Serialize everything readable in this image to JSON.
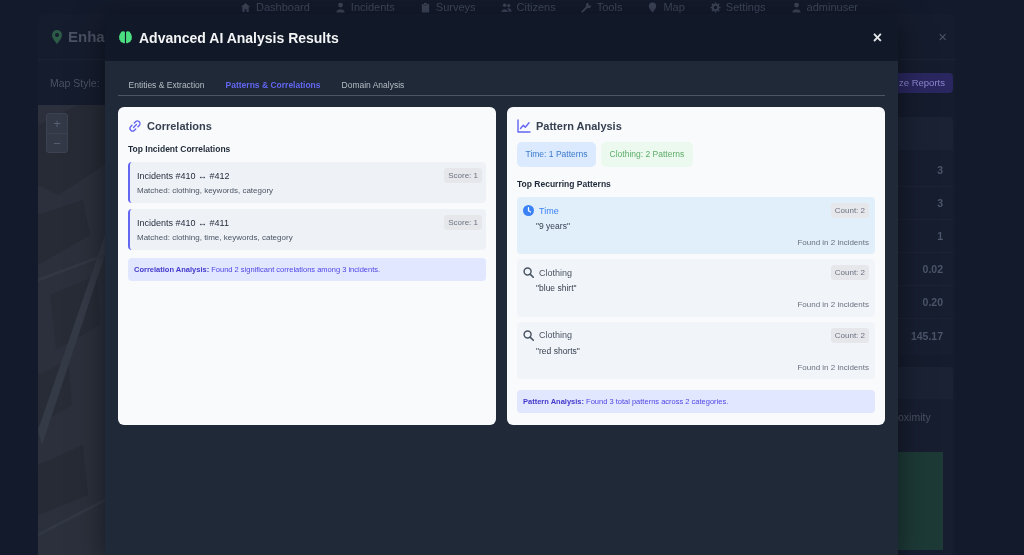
{
  "background_page": {
    "nav_items": [
      "Dashboard",
      "Incidents",
      "Surveys",
      "Citizens",
      "Tools",
      "Map",
      "Settings",
      "adminuser"
    ],
    "panel": {
      "title": "Enha",
      "close": "×",
      "map_style_label": "Map Style:",
      "action_button": "ze Reports",
      "zoom_in": "+",
      "zoom_out": "−",
      "stats_values": [
        "3",
        "3",
        "1",
        "0.02",
        "0.20",
        "145.17"
      ],
      "second_card_text": "oximity"
    }
  },
  "modal": {
    "title": "Advanced AI Analysis Results",
    "close": "×",
    "tabs": [
      {
        "label": "Entities & Extraction",
        "selected": false
      },
      {
        "label": "Patterns & Correlations",
        "selected": true
      },
      {
        "label": "Domain Analysis",
        "selected": false
      }
    ],
    "correlations": {
      "title": "Correlations",
      "subtitle": "Top Incident Correlations",
      "items": [
        {
          "title": "Incidents #410 ↔ #412",
          "score": "Score: 1",
          "matched": "Matched: clothing, keywords, category"
        },
        {
          "title": "Incidents #410 ↔ #411",
          "score": "Score: 1",
          "matched": "Matched: clothing, time, keywords, category"
        }
      ],
      "summary": "**Correlation Analysis:** Found 2 significant correlations among 3 incidents."
    },
    "patterns": {
      "title": "Pattern Analysis",
      "categories": [
        {
          "label": "Time: 1 Patterns",
          "color": "#dbeafe"
        },
        {
          "label": "Clothing: 2 Patterns",
          "color": "#ecf9ee"
        }
      ],
      "subtitle": "Top Recurring Patterns",
      "items": [
        {
          "kind": "time",
          "category": "Time",
          "count": "Count: 2",
          "value": "\"9 years\"",
          "found": "Found in 2 incidents"
        },
        {
          "kind": "clothing",
          "category": "Clothing",
          "count": "Count: 2",
          "value": "\"blue shirt\"",
          "found": "Found in 2 incidents"
        },
        {
          "kind": "clothing",
          "category": "Clothing",
          "count": "Count: 2",
          "value": "\"red shorts\"",
          "found": "Found in 2 incidents"
        }
      ],
      "summary": "**Pattern Analysis:** Found 3 total patterns across 2 categories."
    }
  }
}
